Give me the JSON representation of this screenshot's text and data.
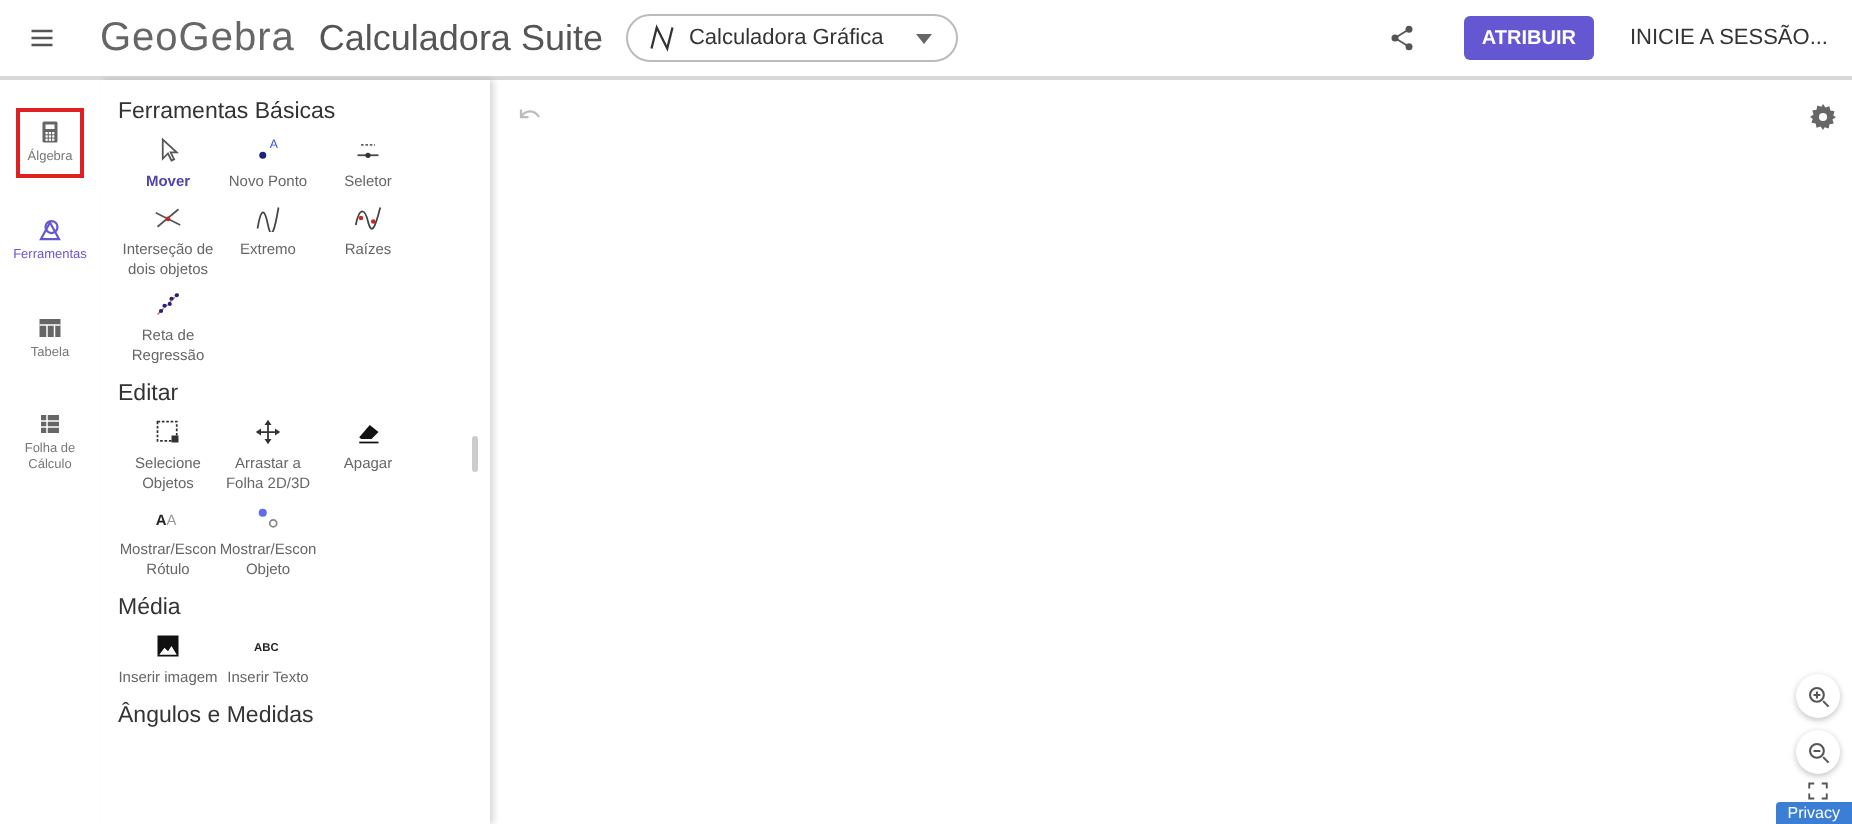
{
  "header": {
    "brand": "GeoGebra",
    "suite": "Calculadora Suite",
    "app_selector": "Calculadora Gráfica",
    "assign_button": "ATRIBUIR",
    "sign_in": "INICIE A SESSÃO..."
  },
  "rail": [
    {
      "label": "Álgebra",
      "selected": false,
      "highlighted": true
    },
    {
      "label": "Ferramentas",
      "selected": true,
      "highlighted": false
    },
    {
      "label": "Tabela",
      "selected": false,
      "highlighted": false
    },
    {
      "label": "Folha de Cálculo",
      "selected": false,
      "highlighted": false
    }
  ],
  "sections": [
    {
      "title": "Ferramentas Básicas",
      "tools": [
        {
          "label": "Mover",
          "selected": true
        },
        {
          "label": "Novo Ponto",
          "selected": false,
          "icon_text": "A"
        },
        {
          "label": "Seletor",
          "selected": false
        },
        {
          "label": "Interseção de dois objetos",
          "selected": false
        },
        {
          "label": "Extremo",
          "selected": false
        },
        {
          "label": "Raízes",
          "selected": false
        },
        {
          "label": "Reta de Regressão",
          "selected": false
        }
      ]
    },
    {
      "title": "Editar",
      "tools": [
        {
          "label": "Selecione Objetos",
          "selected": false
        },
        {
          "label": "Arrastar a Folha 2D/3D",
          "selected": false
        },
        {
          "label": "Apagar",
          "selected": false
        },
        {
          "label": "Mostrar/Escon Rótulo",
          "selected": false,
          "icon_text": "AA"
        },
        {
          "label": "Mostrar/Escon Objeto",
          "selected": false
        }
      ]
    },
    {
      "title": "Média",
      "tools": [
        {
          "label": "Inserir imagem",
          "selected": false
        },
        {
          "label": "Inserir Texto",
          "selected": false,
          "icon_text": "ABC"
        }
      ]
    },
    {
      "title": "Ângulos e Medidas"
    }
  ],
  "privacy_badge": "Privacy"
}
